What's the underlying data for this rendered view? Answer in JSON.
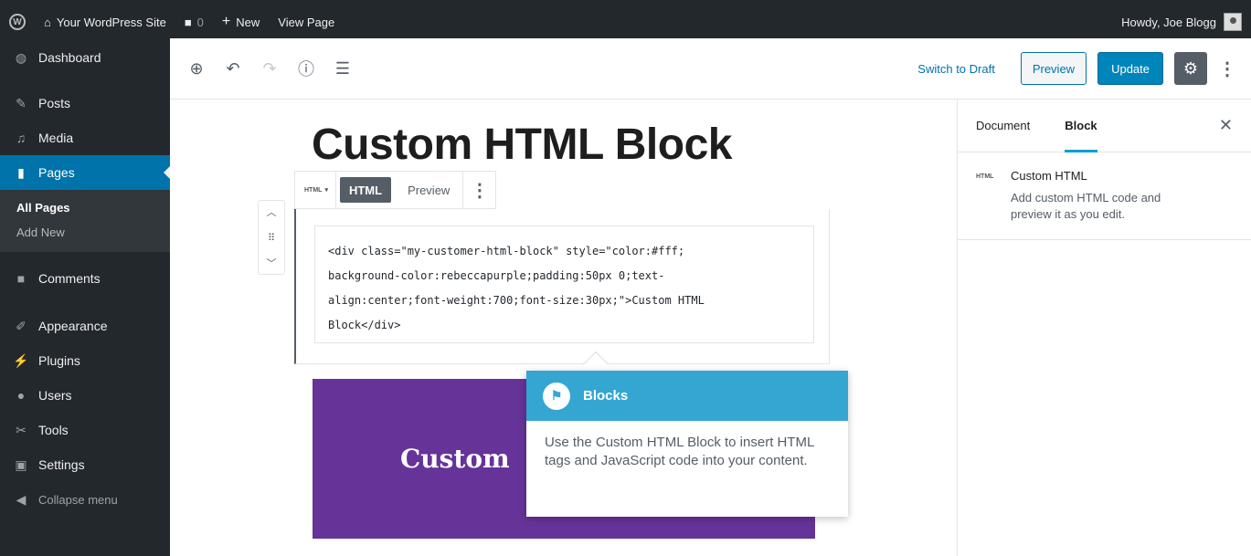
{
  "adminbar": {
    "site_name": "Your WordPress Site",
    "comments_count": "0",
    "new_label": "New",
    "view_page_label": "View Page",
    "howdy": "Howdy, Joe Blogg"
  },
  "sidebar": {
    "items": [
      {
        "label": "Dashboard",
        "icon": "dashboard-icon"
      },
      {
        "label": "Posts",
        "icon": "pin-icon"
      },
      {
        "label": "Media",
        "icon": "media-icon"
      },
      {
        "label": "Pages",
        "icon": "pages-icon"
      },
      {
        "label": "Comments",
        "icon": "comment-icon"
      },
      {
        "label": "Appearance",
        "icon": "brush-icon"
      },
      {
        "label": "Plugins",
        "icon": "plug-icon"
      },
      {
        "label": "Users",
        "icon": "user-icon"
      },
      {
        "label": "Tools",
        "icon": "wrench-icon"
      },
      {
        "label": "Settings",
        "icon": "settings-icon"
      }
    ],
    "submenu": [
      "All Pages",
      "Add New"
    ],
    "collapse_label": "Collapse menu"
  },
  "toolbar": {
    "switch_to_draft": "Switch to Draft",
    "preview": "Preview",
    "update": "Update"
  },
  "settings_panel": {
    "tab_document": "Document",
    "tab_block": "Block",
    "block_badge": "HTML",
    "block_title": "Custom HTML",
    "block_desc": "Add custom HTML code and preview it as you edit."
  },
  "editor": {
    "post_title": "Custom HTML Block",
    "block_switch": "HTML",
    "tab_html": "HTML",
    "tab_preview": "Preview",
    "code_lines": [
      "<div class=\"my-customer-html-block\" style=\"color:#fff;",
      "background-color:rebeccapurple;padding:50px 0;text-",
      "align:center;font-weight:700;font-size:30px;\">Custom HTML",
      "Block</div>"
    ],
    "preview_text": "Custom"
  },
  "tooltip": {
    "title": "Blocks",
    "body": "Use the Custom HTML Block to insert HTML tags and JavaScript code into your content."
  },
  "colors": {
    "admin_dark": "#23282d",
    "active_blue": "#0073aa",
    "preview_purple": "#663399",
    "tooltip_blue": "#35a6d2"
  }
}
